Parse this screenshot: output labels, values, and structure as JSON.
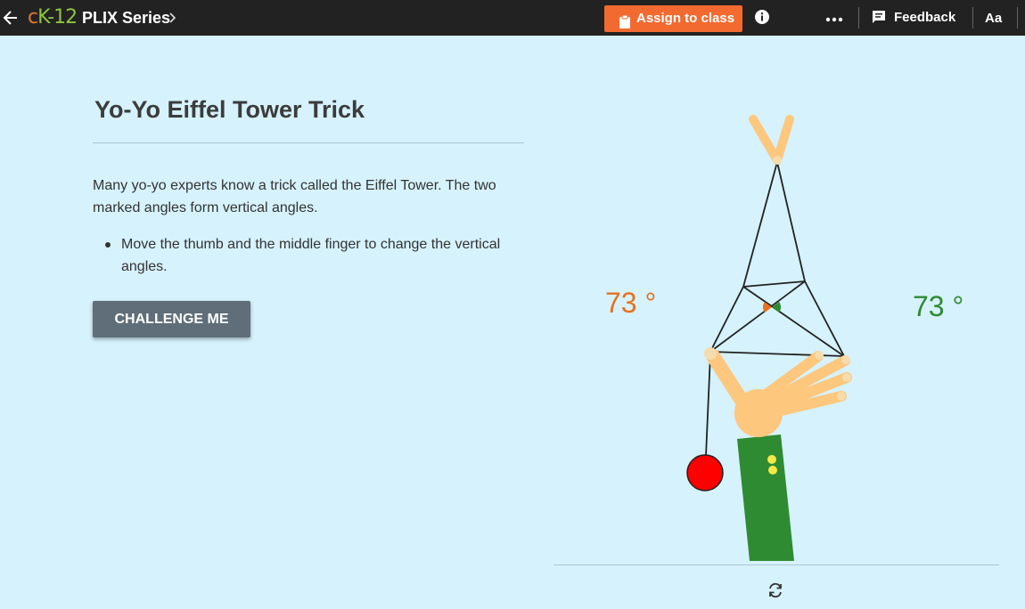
{
  "header": {
    "logo": {
      "c": "c",
      "k": "K",
      "n": "-12"
    },
    "series_title": "PLIX Series",
    "assign_label": "Assign to class",
    "feedback_label": "Feedback",
    "font_size_label": "Aa",
    "icons": {
      "back": "arrow-left-icon",
      "chevron": "chevron-right-icon",
      "clipboard": "clipboard-icon",
      "info": "info-icon",
      "more": "more-dots-icon",
      "feedback": "feedback-icon"
    }
  },
  "content": {
    "title": "Yo-Yo Eiffel Tower Trick",
    "description": "Many yo-yo experts know a trick called the Eiffel Tower. The two marked angles form vertical angles.",
    "bullets": [
      "Move the thumb and the middle finger to change the vertical angles."
    ],
    "challenge_label": "CHALLENGE ME"
  },
  "simulation": {
    "left_angle": "73 °",
    "right_angle": "73 °",
    "reset_icon": "refresh-icon"
  },
  "colors": {
    "topbar": "#222222",
    "background": "#d6f2fc",
    "assign_button": "#f26a30",
    "challenge_button": "#5f6e78",
    "left_angle": "#e8701e",
    "right_angle": "#2e8b31",
    "sleeve": "#2e8b31",
    "skin": "#fdc77e",
    "yoyo": "#ff0000"
  }
}
